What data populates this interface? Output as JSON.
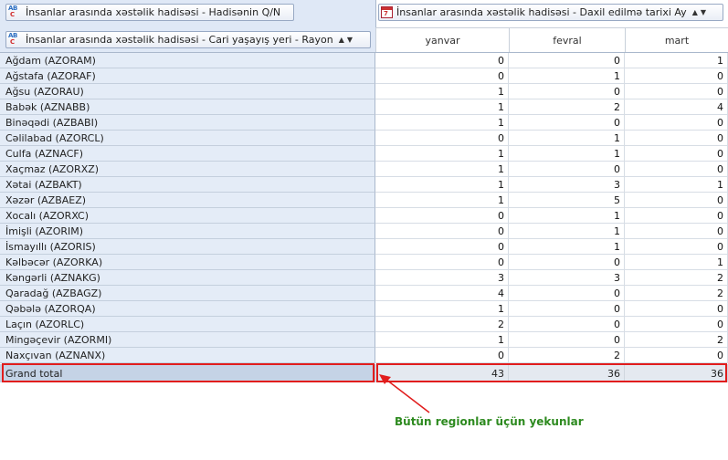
{
  "row_field": {
    "label": "İnsanlar arasında xəstəlik hadisəsi - Cari yaşayış yeri - Rayon",
    "sort_up": "▲",
    "filter": "▼"
  },
  "data_field": {
    "label": "İnsanlar arasında xəstəlik hadisəsi - Hadisənin Q/N"
  },
  "column_field": {
    "label": "İnsanlar arasında xəstəlik hadisəsi - Daxil edilmə tarixi Ay",
    "sort_up": "▲",
    "filter": "▼"
  },
  "columns": [
    "yanvar",
    "fevral",
    "mart"
  ],
  "rows": [
    {
      "label": "Ağdam (AZORAM)",
      "values": [
        "0",
        "0",
        "1"
      ]
    },
    {
      "label": "Ağstafa (AZORAF)",
      "values": [
        "0",
        "1",
        "0"
      ]
    },
    {
      "label": "Ağsu (AZORAU)",
      "values": [
        "1",
        "0",
        "0"
      ]
    },
    {
      "label": "Babək (AZNABB)",
      "values": [
        "1",
        "2",
        "4"
      ]
    },
    {
      "label": "Binəqədi (AZBABI)",
      "values": [
        "1",
        "0",
        "0"
      ]
    },
    {
      "label": "Cəlilabad (AZORCL)",
      "values": [
        "0",
        "1",
        "0"
      ]
    },
    {
      "label": "Culfa (AZNACF)",
      "values": [
        "1",
        "1",
        "0"
      ]
    },
    {
      "label": "Xaçmaz (AZORXZ)",
      "values": [
        "1",
        "0",
        "0"
      ]
    },
    {
      "label": "Xətai (AZBAKT)",
      "values": [
        "1",
        "3",
        "1"
      ]
    },
    {
      "label": "Xəzər (AZBAEZ)",
      "values": [
        "1",
        "5",
        "0"
      ]
    },
    {
      "label": "Xocalı (AZORXC)",
      "values": [
        "0",
        "1",
        "0"
      ]
    },
    {
      "label": "İmişli (AZORIM)",
      "values": [
        "0",
        "1",
        "0"
      ]
    },
    {
      "label": "İsmayıllı (AZORIS)",
      "values": [
        "0",
        "1",
        "0"
      ]
    },
    {
      "label": "Kəlbəcər (AZORKA)",
      "values": [
        "0",
        "0",
        "1"
      ]
    },
    {
      "label": "Kəngərli (AZNAKG)",
      "values": [
        "3",
        "3",
        "2"
      ]
    },
    {
      "label": "Qaradağ (AZBAGZ)",
      "values": [
        "4",
        "0",
        "2"
      ]
    },
    {
      "label": "Qəbələ (AZORQA)",
      "values": [
        "1",
        "0",
        "0"
      ]
    },
    {
      "label": "Laçın (AZORLC)",
      "values": [
        "2",
        "0",
        "0"
      ]
    },
    {
      "label": "Mingəçevir (AZORMI)",
      "values": [
        "1",
        "0",
        "2"
      ]
    },
    {
      "label": "Naxçıvan (AZNANX)",
      "values": [
        "0",
        "2",
        "0"
      ]
    }
  ],
  "grand_total": {
    "label": "Grand total",
    "values": [
      "43",
      "36",
      "36"
    ]
  },
  "annotation": "Bütün regionlar üçün yekunlar",
  "colors": {
    "highlight": "#e11d1d",
    "annotation": "#2d8a1f"
  }
}
